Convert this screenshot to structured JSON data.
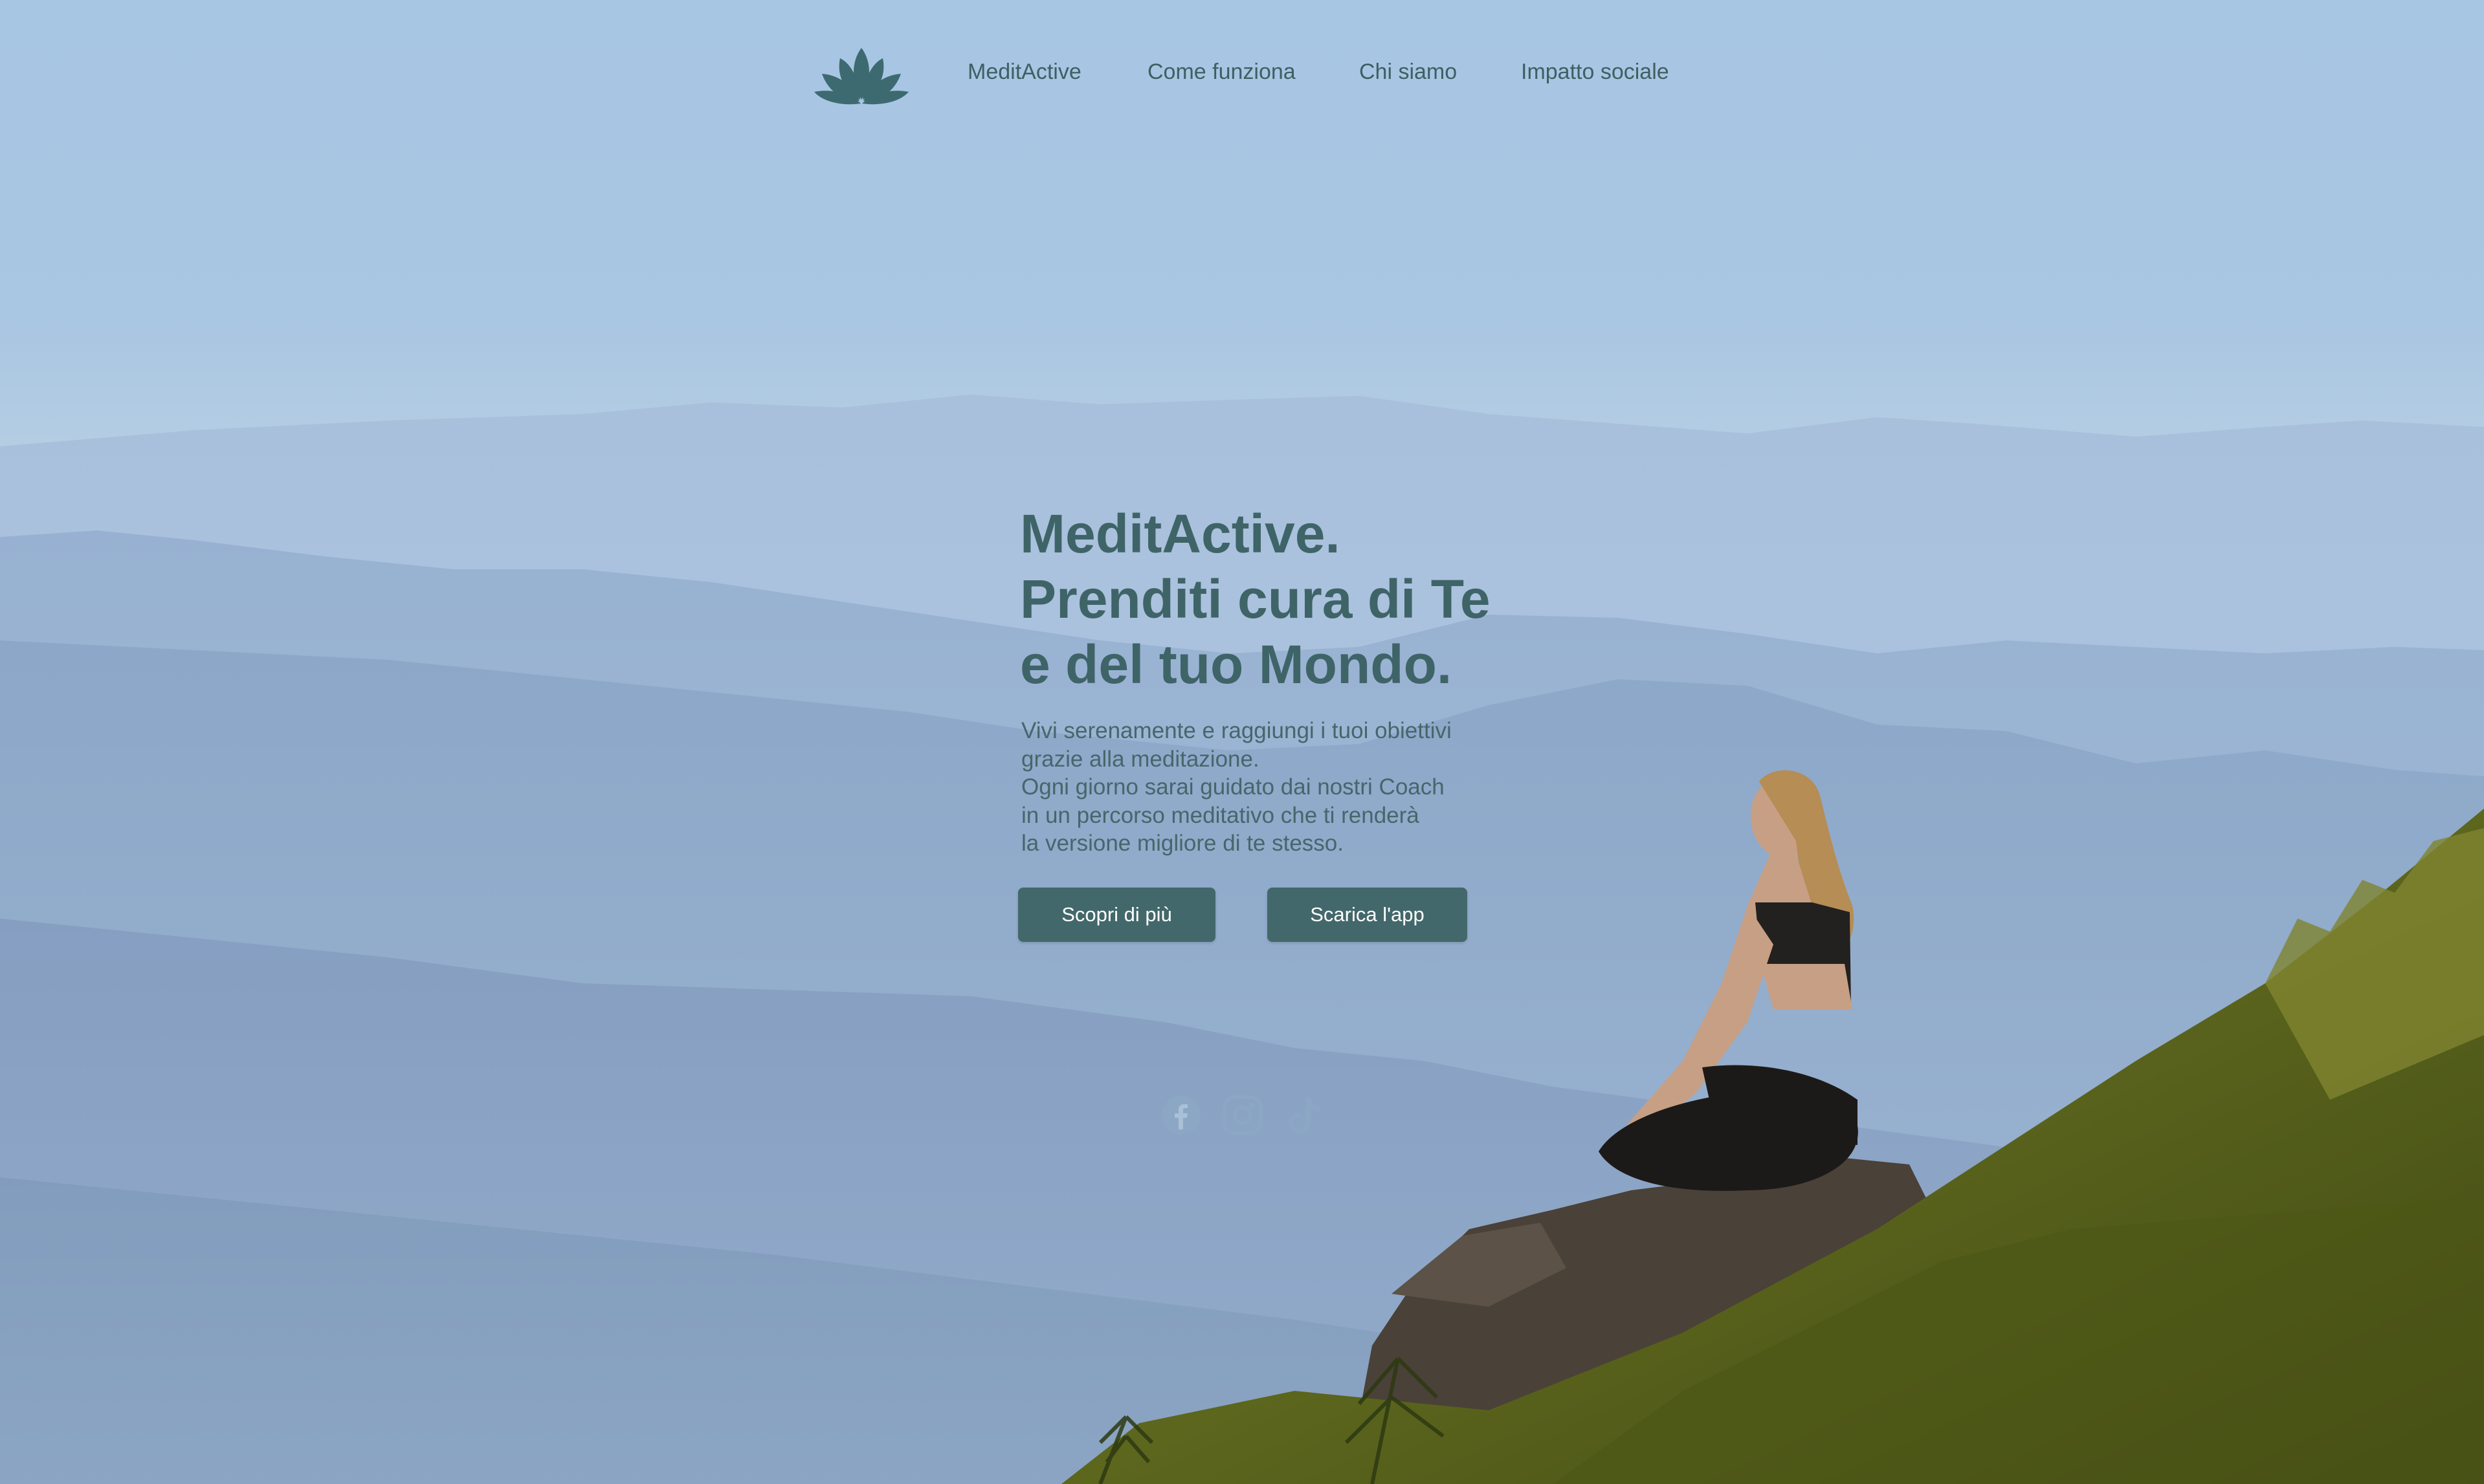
{
  "nav": {
    "logo": "lotus-icon",
    "links": [
      {
        "label": "MeditActive"
      },
      {
        "label": "Come funziona"
      },
      {
        "label": "Chi siamo"
      },
      {
        "label": "Impatto sociale"
      }
    ]
  },
  "hero": {
    "headline": [
      "MeditActive.",
      "Prenditi cura di Te",
      "e del tuo Mondo."
    ],
    "description": [
      "Vivi serenamente e raggiungi i tuoi obiettivi",
      "grazie alla meditazione.",
      "Ogni giorno sarai guidato dai nostri Coach",
      "in un percorso meditativo che ti renderà",
      "la versione migliore di te stesso."
    ],
    "buttons": [
      {
        "label": "Scopri di più"
      },
      {
        "label": "Scarica l'app"
      }
    ]
  },
  "social": [
    {
      "icon": "facebook-icon"
    },
    {
      "icon": "instagram-icon"
    },
    {
      "icon": "tiktok-icon"
    }
  ],
  "colors": {
    "accent": "#43686b",
    "text": "#3f6468",
    "nav_text": "#3f5f63",
    "button_text": "#ffffff",
    "sky": "#a7c6e3",
    "grass": "#5e6a1f"
  }
}
